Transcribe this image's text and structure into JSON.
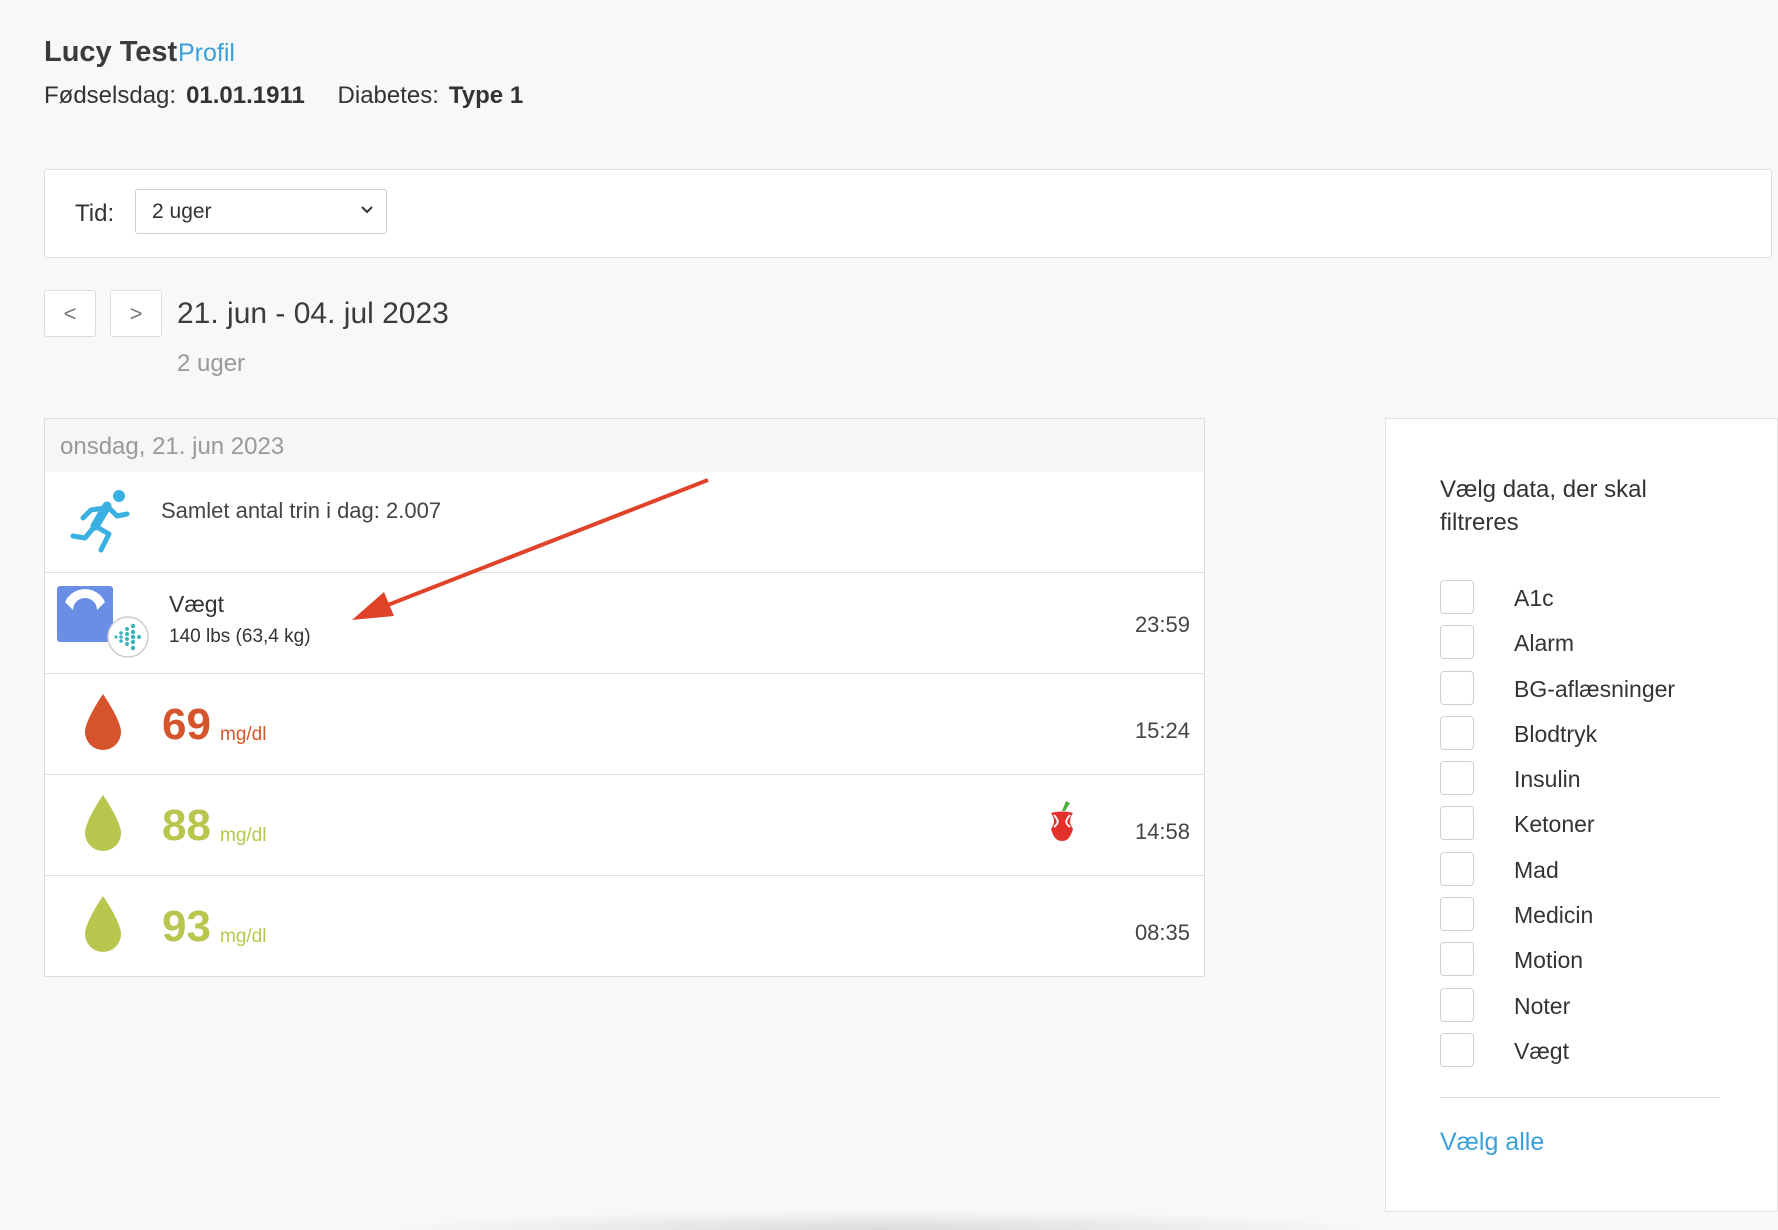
{
  "patient": {
    "name": "Lucy Test",
    "profile_link": "Profil",
    "birthday_label": "Fødselsdag:",
    "birthday": "01.01.1911",
    "diabetes_label": "Diabetes:",
    "diabetes": "Type 1"
  },
  "filter": {
    "label": "Tid:",
    "selected": "2 uger"
  },
  "nav": {
    "prev": "<",
    "next": ">",
    "range": "21. jun - 04. jul 2023",
    "subtitle": "2 uger"
  },
  "log": {
    "day_header": "onsdag, 21. jun 2023",
    "steps": {
      "icon": "running-person-icon",
      "text": "Samlet antal trin i dag: 2.007"
    },
    "weight": {
      "icon": "scale-icon",
      "source_icon": "fitbit-icon",
      "title": "Vægt",
      "value": "140 lbs (63,4 kg)",
      "time": "23:59"
    },
    "readings": [
      {
        "value": "69",
        "unit": "mg/dl",
        "time": "15:24",
        "color": "#d5542b",
        "food": false
      },
      {
        "value": "88",
        "unit": "mg/dl",
        "time": "14:58",
        "color": "#b8c64e",
        "food": true
      },
      {
        "value": "93",
        "unit": "mg/dl",
        "time": "08:35",
        "color": "#b8c64e",
        "food": false
      }
    ]
  },
  "sidebar": {
    "title": "Vælg data, der skal filtreres",
    "options": [
      "A1c",
      "Alarm",
      "BG-aflæsninger",
      "Blodtryk",
      "Insulin",
      "Ketoner",
      "Mad",
      "Medicin",
      "Motion",
      "Noter",
      "Vægt"
    ],
    "select_all": "Vælg alle"
  },
  "colors": {
    "link": "#3aa0dc",
    "annotation_arrow": "#e0432a"
  }
}
